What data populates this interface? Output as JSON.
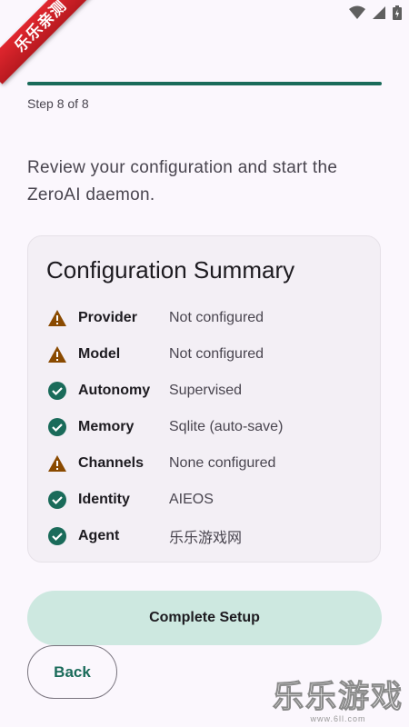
{
  "status_bar": {
    "icons": [
      "wifi-icon",
      "signal-icon",
      "battery-icon"
    ]
  },
  "ribbon_text": "乐乐亲测",
  "progress": {
    "fraction": 1.0,
    "step_label": "Step 8 of 8"
  },
  "intro_text": "Review your configuration and start the ZeroAI daemon.",
  "summary": {
    "title": "Configuration Summary",
    "rows": [
      {
        "key": "Provider",
        "value": "Not configured",
        "status": "warning"
      },
      {
        "key": "Model",
        "value": "Not configured",
        "status": "warning"
      },
      {
        "key": "Autonomy",
        "value": "Supervised",
        "status": "ok"
      },
      {
        "key": "Memory",
        "value": "Sqlite (auto-save)",
        "status": "ok"
      },
      {
        "key": "Channels",
        "value": "None configured",
        "status": "warning"
      },
      {
        "key": "Identity",
        "value": "AIEOS",
        "status": "ok"
      },
      {
        "key": "Agent",
        "value": "乐乐游戏网",
        "status": "ok"
      }
    ]
  },
  "buttons": {
    "complete": "Complete Setup",
    "back": "Back"
  },
  "watermark": {
    "title": "乐乐游戏",
    "url": "www.6ll.com"
  },
  "colors": {
    "accent": "#1a6b5a",
    "warning": "#8a4a00",
    "ok": "#1a6b5a",
    "button_bg": "#cde8e0"
  }
}
